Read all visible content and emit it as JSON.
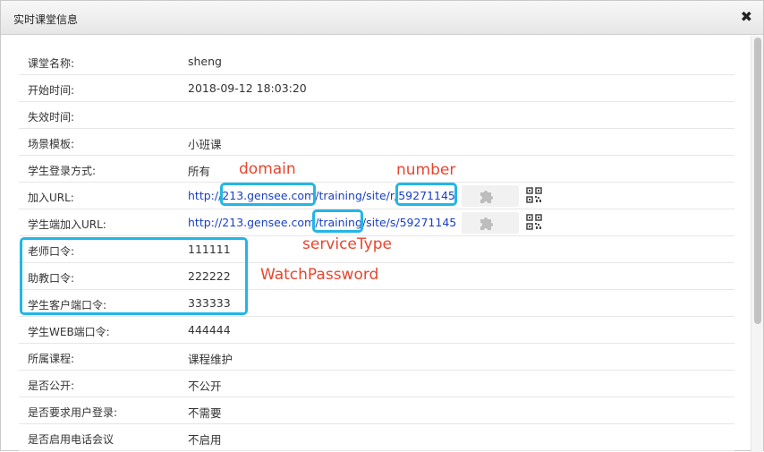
{
  "dialog": {
    "title": "实时课堂信息",
    "close_symbol": "✖"
  },
  "rows": [
    {
      "label": "课堂名称:",
      "value": "sheng"
    },
    {
      "label": "开始时间:",
      "value": "2018-09-12 18:03:20"
    },
    {
      "label": "失效时间:",
      "value": ""
    },
    {
      "label": "场景模板:",
      "value": "小班课"
    },
    {
      "label": "学生登录方式:",
      "value": "所有"
    },
    {
      "label": "加入URL:",
      "value": "http://213.gensee.com/training/site/r/59271145"
    },
    {
      "label": "学生端加入URL:",
      "value": "http://213.gensee.com/training/site/s/59271145"
    },
    {
      "label": "老师口令:",
      "value": "111111"
    },
    {
      "label": "助教口令:",
      "value": "222222"
    },
    {
      "label": "学生客户端口令:",
      "value": "333333"
    },
    {
      "label": "学生WEB端口令:",
      "value": "444444"
    },
    {
      "label": "所属课程:",
      "value": "课程维护"
    },
    {
      "label": "是否公开:",
      "value": "不公开"
    },
    {
      "label": "是否要求用户登录:",
      "value": "不需要"
    },
    {
      "label": "是否启用电话会议",
      "value": "不启用"
    }
  ],
  "annotations": {
    "domain": "domain",
    "number": "number",
    "service_type": "serviceType",
    "watch_password": "WatchPassword"
  },
  "icons": {
    "plugin": "puzzle-piece-icon",
    "qr": "qr-code-icon"
  },
  "colors": {
    "highlight": "#22b6e6",
    "annotation": "#e8452f",
    "link": "#1a3fc0"
  }
}
